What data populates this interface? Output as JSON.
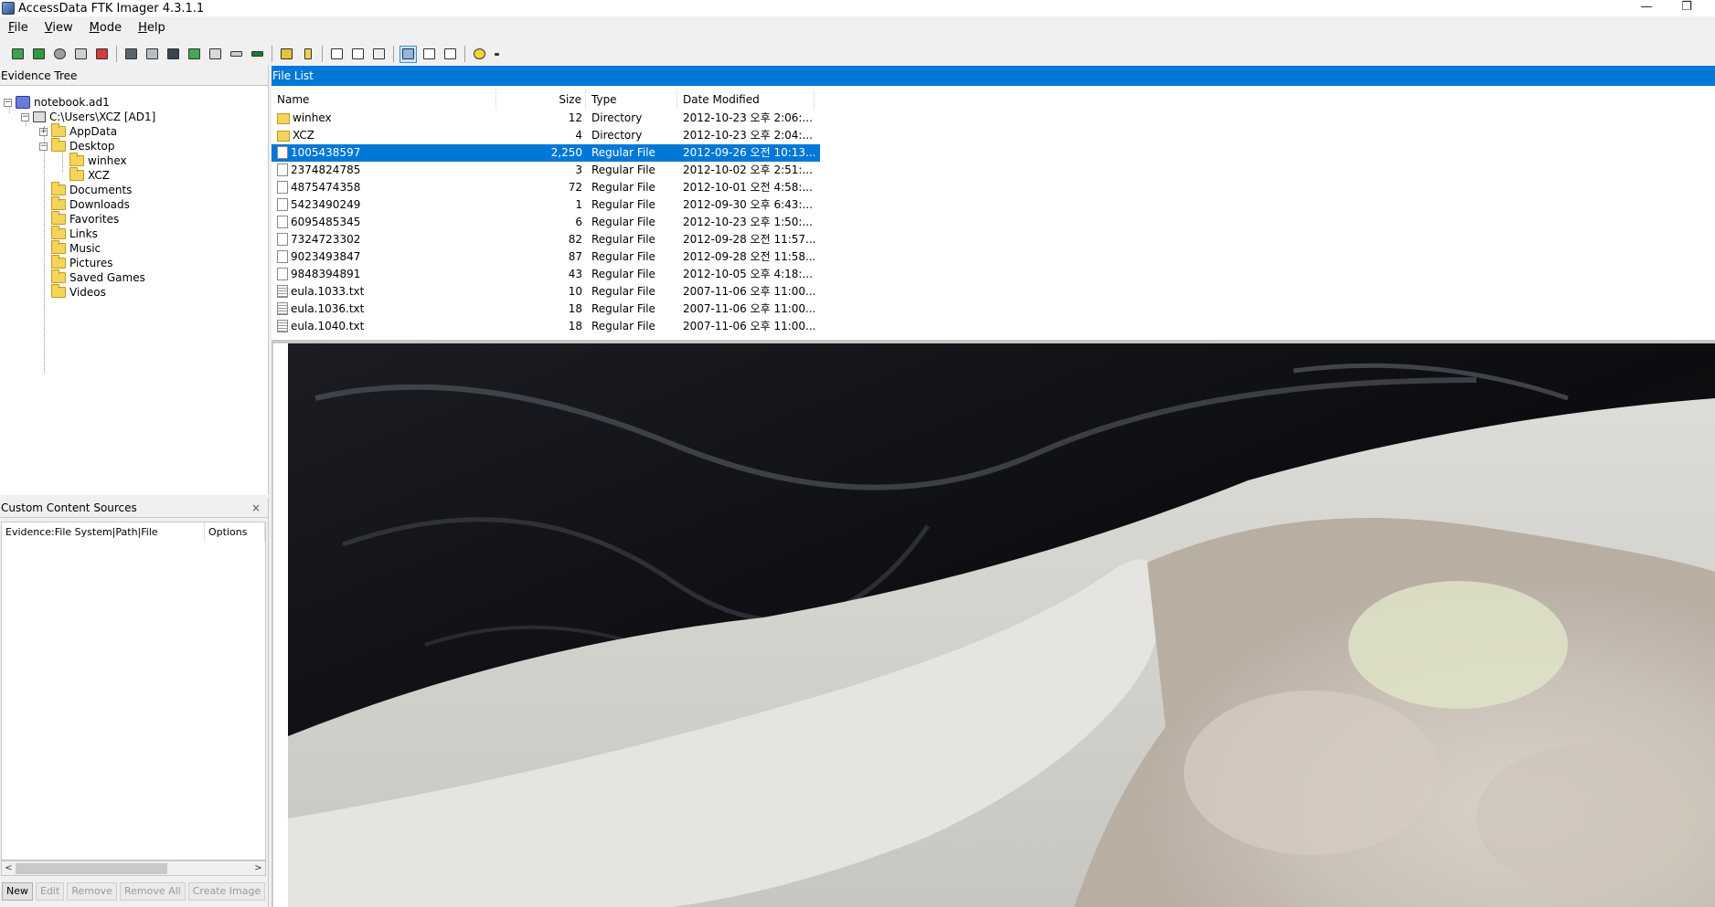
{
  "window": {
    "title": "AccessData FTK Imager 4.3.1.1",
    "minimize_glyph": "—",
    "restore_glyph": "❐"
  },
  "menu": [
    {
      "accel": "F",
      "rest": "ile"
    },
    {
      "accel": "V",
      "rest": "iew"
    },
    {
      "accel": "M",
      "rest": "ode"
    },
    {
      "accel": "H",
      "rest": "elp"
    }
  ],
  "toolbar": {
    "icons": [
      "add-evidence-icon",
      "add-all-evidence-icon",
      "image-mounting-icon",
      "remove-evidence-icon",
      "remove-all-evidence-icon",
      "create-disk-image-icon",
      "export-disk-image-icon",
      "export-logical-image-icon",
      "capture-memory-icon",
      "obtain-protected-files-icon",
      "detect-encryption-icon",
      "memory-icon",
      "export-files-icon",
      "export-file-hash-icon",
      "properties-icon",
      "hex-value-interpreter-icon",
      "custom-content-sources-icon",
      "auto-view-icon",
      "text-view-icon",
      "hex-view-icon",
      "help-icon",
      "overflow-icon"
    ],
    "accent": "#0078d7"
  },
  "evidence_tree": {
    "header": "Evidence Tree",
    "root": "notebook.ad1",
    "volume": "C:\\Users\\XCZ [AD1]",
    "items": [
      "AppData",
      "Desktop",
      "winhex",
      "XCZ",
      "Documents",
      "Downloads",
      "Favorites",
      "Links",
      "Music",
      "Pictures",
      "Saved Games",
      "Videos"
    ]
  },
  "custom_sources": {
    "header": "Custom Content Sources",
    "close_glyph": "×",
    "col1": "Evidence:File System|Path|File",
    "col2": "Options",
    "scroll_left": "<",
    "scroll_right": ">",
    "buttons": {
      "new": "New",
      "edit": "Edit",
      "remove": "Remove",
      "remove_all": "Remove All",
      "create_image": "Create Image"
    }
  },
  "file_list": {
    "header": "File List",
    "columns": {
      "name": "Name",
      "size": "Size",
      "type": "Type",
      "date": "Date Modified"
    },
    "rows": [
      {
        "name": "winhex",
        "size": "12",
        "type": "Directory",
        "date": "2012-10-23 오후 2:06:..."
      },
      {
        "name": "XCZ",
        "size": "4",
        "type": "Directory",
        "date": "2012-10-23 오후 2:04:..."
      },
      {
        "name": "1005438597",
        "size": "2,250",
        "type": "Regular File",
        "date": "2012-09-26 오전 10:13..."
      },
      {
        "name": "2374824785",
        "size": "3",
        "type": "Regular File",
        "date": "2012-10-02 오후 2:51:..."
      },
      {
        "name": "4875474358",
        "size": "72",
        "type": "Regular File",
        "date": "2012-10-01 오전 4:58:..."
      },
      {
        "name": "5423490249",
        "size": "1",
        "type": "Regular File",
        "date": "2012-09-30 오후 6:43:..."
      },
      {
        "name": "6095485345",
        "size": "6",
        "type": "Regular File",
        "date": "2012-10-23 오후 1:50:..."
      },
      {
        "name": "7324723302",
        "size": "82",
        "type": "Regular File",
        "date": "2012-09-28 오전 11:57..."
      },
      {
        "name": "9023493847",
        "size": "87",
        "type": "Regular File",
        "date": "2012-09-28 오전 11:58..."
      },
      {
        "name": "9848394891",
        "size": "43",
        "type": "Regular File",
        "date": "2012-10-05 오후 4:18:..."
      },
      {
        "name": "eula.1033.txt",
        "size": "10",
        "type": "Regular File",
        "date": "2007-11-06 오후 11:00..."
      },
      {
        "name": "eula.1036.txt",
        "size": "18",
        "type": "Regular File",
        "date": "2007-11-06 오후 11:00..."
      },
      {
        "name": "eula.1040.txt",
        "size": "18",
        "type": "Regular File",
        "date": "2007-11-06 오후 11:00..."
      }
    ]
  }
}
